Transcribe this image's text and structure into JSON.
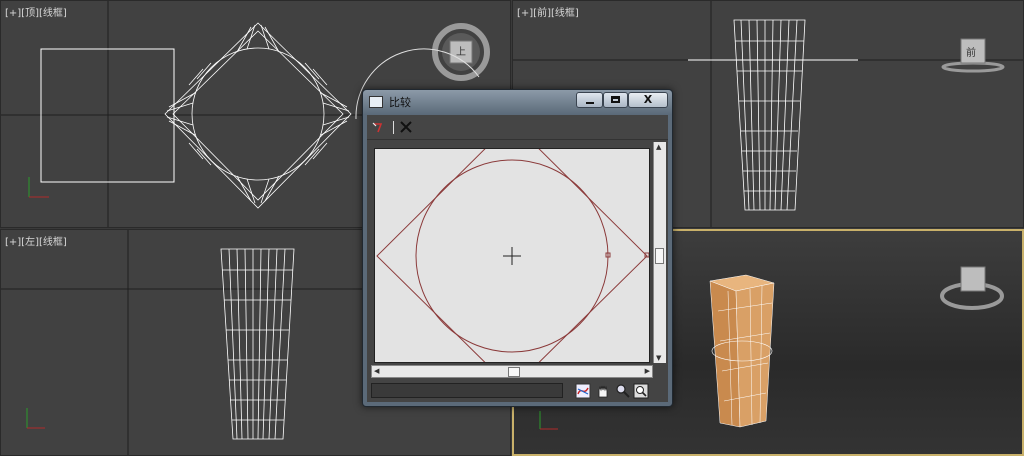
{
  "viewports": {
    "top": {
      "label": "[+][顶][线框]"
    },
    "front": {
      "label": "[+][前][线框]"
    },
    "left": {
      "label": "[+][左][线框]"
    },
    "perspective": {
      "label": ""
    }
  },
  "view_cube": {
    "top_face": "上",
    "front_face": "前"
  },
  "dialog": {
    "title": "比较",
    "minimize_label": "minimize",
    "maximize_label": "maximize",
    "close_label": "X",
    "toolbar": {
      "pick_icon": "pick-curve-icon",
      "delete_icon": "delete-icon"
    },
    "status_icons": [
      "display-toggle-icon",
      "pan-hand-icon",
      "zoom-icon",
      "zoom-extents-icon"
    ]
  },
  "colors": {
    "viewport_bg": "#414141",
    "wire": "#ffffff",
    "curve": "#8b3a3a",
    "column_fill": "#d9a066",
    "active_border": "#c9b16a"
  }
}
